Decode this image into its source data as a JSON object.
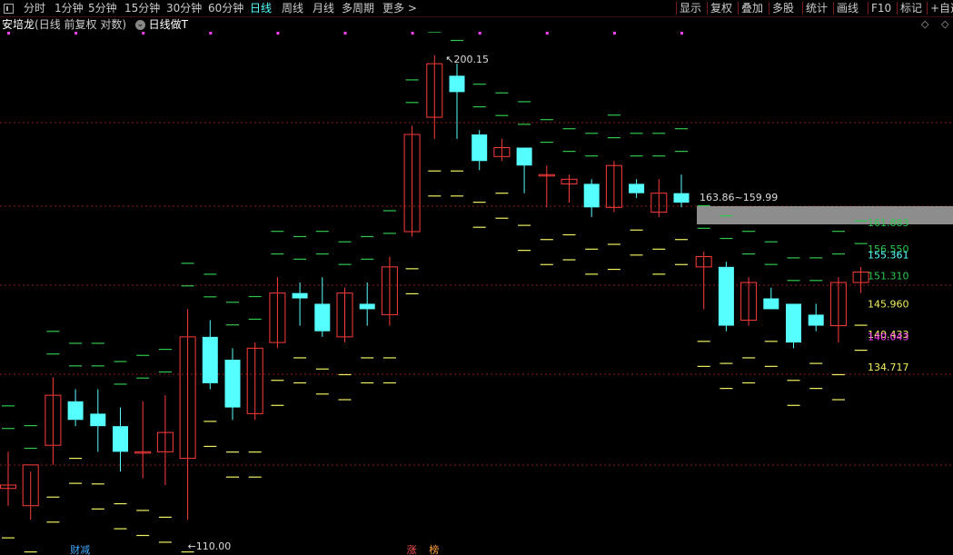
{
  "toolbar": {
    "periods": [
      "分时",
      "1分钟",
      "5分钟",
      "15分钟",
      "30分钟",
      "60分钟",
      "日线",
      "周线",
      "月线",
      "多周期",
      "更多 >"
    ],
    "active_period": "日线",
    "tools": [
      "显示",
      "复权",
      "叠加",
      "多股",
      "统计",
      "画线",
      "F10",
      "标记",
      "+自选"
    ]
  },
  "info": {
    "stock_name": "安培龙",
    "params": "(日线 前复权 对数)",
    "indicator": "日线做T",
    "icon": "chevron-circle-icon"
  },
  "window_icons": {
    "diamond": "◇",
    "gear": "◇"
  },
  "bottom_markers": [
    {
      "text": "财减",
      "color": "#3fa9ff",
      "index": 3
    },
    {
      "text": "涨",
      "color": "#ff5050",
      "index": 18
    },
    {
      "text": "榜",
      "color": "#ff9f40",
      "index": 19
    }
  ],
  "colors": {
    "up": "#ff3b3b",
    "down": "#5ff",
    "green": "#2dc84d",
    "yellow": "#f0f060",
    "magenta": "#ff40ff",
    "gridline": "#8b1a1a"
  },
  "chart_data": {
    "type": "candlestick",
    "title": "安培龙",
    "scale": "log",
    "ylim": [
      107.5,
      205
    ],
    "grid": true,
    "high_label": "200.15",
    "low_label": "110.00",
    "range_label": "163.86~159.99",
    "candles": [
      {
        "o": 115.5,
        "h": 121,
        "l": 113,
        "c": 116.0
      },
      {
        "o": 113,
        "h": 118,
        "l": 111,
        "c": 119
      },
      {
        "o": 122,
        "h": 133,
        "l": 119,
        "c": 130
      },
      {
        "o": 129,
        "h": 131,
        "l": 125,
        "c": 126
      },
      {
        "o": 127,
        "h": 131,
        "l": 121,
        "c": 125
      },
      {
        "o": 125,
        "h": 128,
        "l": 118,
        "c": 121
      },
      {
        "o": 121,
        "h": 129,
        "l": 117,
        "c": 121
      },
      {
        "o": 121,
        "h": 130,
        "l": 116,
        "c": 124
      },
      {
        "o": 120,
        "h": 145,
        "l": 111,
        "c": 140
      },
      {
        "o": 140,
        "h": 143,
        "l": 131,
        "c": 132
      },
      {
        "o": 136,
        "h": 138,
        "l": 126,
        "c": 128
      },
      {
        "o": 127,
        "h": 139,
        "l": 126,
        "c": 138
      },
      {
        "o": 139,
        "h": 151,
        "l": 138,
        "c": 148
      },
      {
        "o": 148,
        "h": 150,
        "l": 142,
        "c": 147
      },
      {
        "o": 146,
        "h": 151,
        "l": 140,
        "c": 141
      },
      {
        "o": 140,
        "h": 149,
        "l": 139,
        "c": 148
      },
      {
        "o": 146,
        "h": 150,
        "l": 142,
        "c": 145
      },
      {
        "o": 144,
        "h": 155,
        "l": 142,
        "c": 153
      },
      {
        "o": 160,
        "h": 183,
        "l": 159,
        "c": 181
      },
      {
        "o": 185,
        "h": 200.15,
        "l": 180,
        "c": 198
      },
      {
        "o": 195,
        "h": 198,
        "l": 180,
        "c": 191
      },
      {
        "o": 181,
        "h": 182,
        "l": 173,
        "c": 175
      },
      {
        "o": 176,
        "h": 180,
        "l": 175,
        "c": 178
      },
      {
        "o": 178,
        "h": 178,
        "l": 168,
        "c": 174
      },
      {
        "o": 172,
        "h": 174,
        "l": 165,
        "c": 172
      },
      {
        "o": 170,
        "h": 172,
        "l": 166,
        "c": 171
      },
      {
        "o": 170,
        "h": 171,
        "l": 163,
        "c": 165
      },
      {
        "o": 165,
        "h": 175,
        "l": 164,
        "c": 174
      },
      {
        "o": 170,
        "h": 171,
        "l": 167,
        "c": 168
      },
      {
        "o": 164,
        "h": 171,
        "l": 163,
        "c": 168
      },
      {
        "o": 168,
        "h": 172,
        "l": 165,
        "c": 166
      },
      {
        "o": 153,
        "h": 156,
        "l": 145,
        "c": 155
      },
      {
        "o": 153,
        "h": 154,
        "l": 141,
        "c": 142
      },
      {
        "o": 143,
        "h": 151,
        "l": 142,
        "c": 150
      },
      {
        "o": 147,
        "h": 149,
        "l": 145,
        "c": 145
      },
      {
        "o": 146,
        "h": 146,
        "l": 138,
        "c": 139
      },
      {
        "o": 144,
        "h": 146,
        "l": 141,
        "c": 142
      },
      {
        "o": 142,
        "h": 151,
        "l": 139,
        "c": 150
      },
      {
        "o": 150,
        "h": 153,
        "l": 148,
        "c": 152
      }
    ],
    "right_labels": [
      {
        "text": "161.883",
        "value": 161.883,
        "color": "#2dc84d"
      },
      {
        "text": "156.550",
        "value": 156.55,
        "color": "#2dc84d"
      },
      {
        "text": "155.361",
        "value": 155.361,
        "color": "#5ff"
      },
      {
        "text": "151.310",
        "value": 151.31,
        "color": "#2dc84d"
      },
      {
        "text": "145.960",
        "value": 145.96,
        "color": "#f0f060"
      },
      {
        "text": "140.433",
        "value": 140.433,
        "color": "#f0f060"
      },
      {
        "text": "140.043",
        "value": 140.043,
        "color": "#ff40ff"
      },
      {
        "text": "134.717",
        "value": 134.717,
        "color": "#f0f060"
      }
    ]
  }
}
